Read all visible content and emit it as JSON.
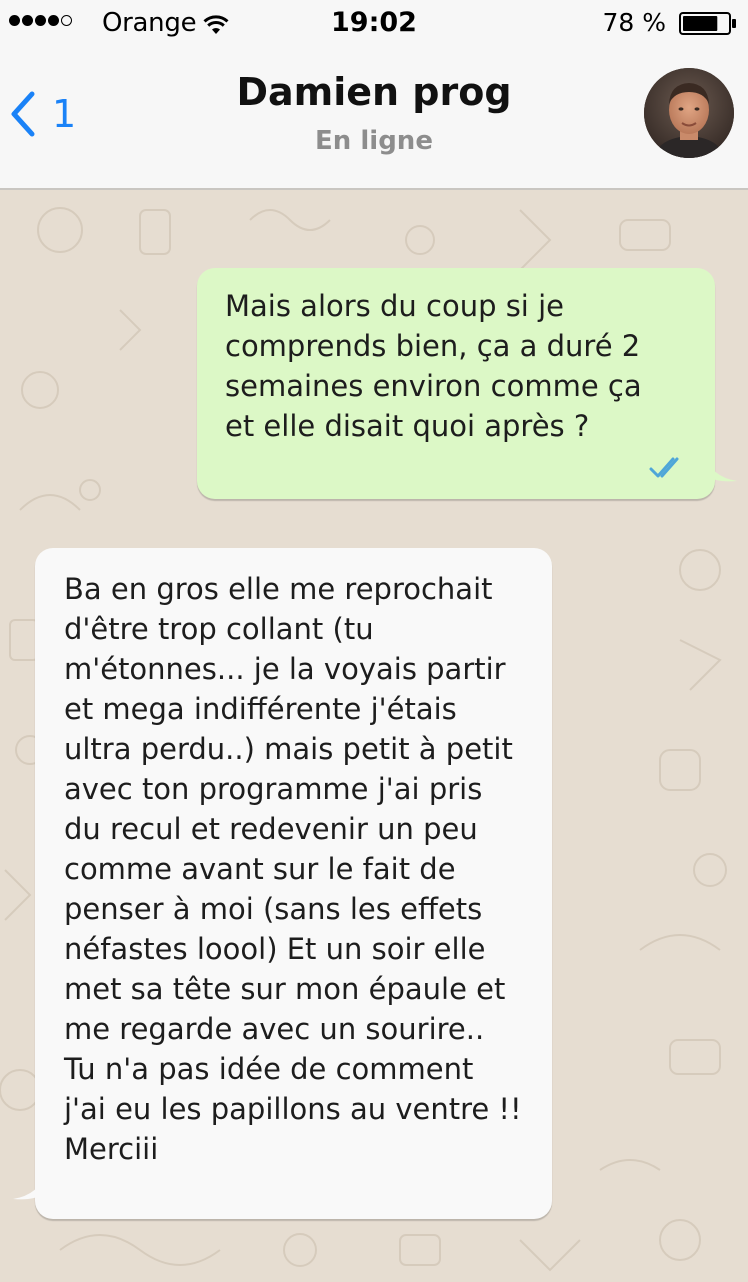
{
  "status_bar": {
    "carrier": "Orange",
    "time": "19:02",
    "battery_percent": "78 %",
    "battery_level": 0.78,
    "signal_bars_filled": 4,
    "signal_bars_total": 5
  },
  "header": {
    "back_count": "1",
    "contact_name": "Damien prog",
    "contact_status": "En ligne",
    "accent_color": "#1a82f7"
  },
  "messages": [
    {
      "direction": "outgoing",
      "lines": [
        "Mais alors du coup si je",
        "comprends bien, ça a duré 2",
        "semaines environ comme ça",
        "et elle disait quoi après ?"
      ],
      "status_icon": "double-check-read-icon"
    },
    {
      "direction": "incoming",
      "lines": [
        "Ba en gros elle me reprochait",
        "d'être trop collant (tu",
        "m'étonnes... je la voyais partir",
        "et mega indifférente j'étais",
        "ultra perdu..) mais petit à petit",
        "avec ton programme j'ai pris",
        "du recul et redevenir un peu",
        "comme avant sur le fait de",
        "penser à moi (sans les effets",
        "néfastes loool) Et un soir elle",
        "met sa tête sur mon épaule et",
        "me regarde avec un sourire..",
        "Tu n'a pas idée de comment",
        "j'ai eu les papillons au ventre !!",
        "Merciii"
      ]
    }
  ],
  "colors": {
    "outgoing_bubble": "#dcf8c6",
    "incoming_bubble": "#f9f9f9",
    "chat_background": "#e6ddd1",
    "read_ticks": "#4fa6d8"
  }
}
